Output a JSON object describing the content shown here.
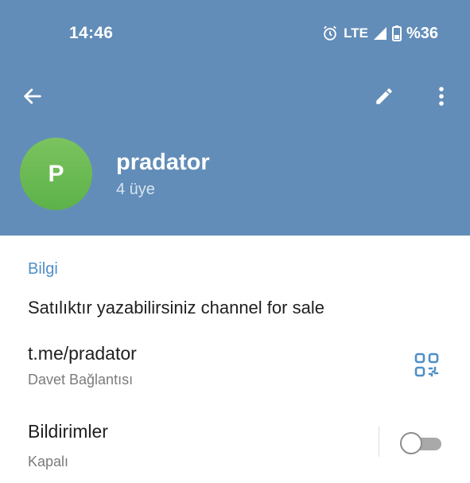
{
  "status_bar": {
    "time": "14:46",
    "network": "LTE",
    "battery": "%36",
    "icons": [
      "alarm-icon",
      "signal-icon",
      "battery-icon"
    ]
  },
  "toolbar": {
    "icons": [
      "back-arrow-icon",
      "edit-pencil-icon",
      "more-vert-icon"
    ]
  },
  "profile": {
    "avatar_letter": "P",
    "name": "pradator",
    "members": "4 üye"
  },
  "info": {
    "section_title": "Bilgi",
    "description": "Satılıktır yazabilirsiniz channel for sale",
    "link": "t.me/pradator",
    "link_caption": "Davet Bağlantısı",
    "link_icon": "qr-code-icon"
  },
  "notifications": {
    "title": "Bildirimler",
    "state": "Kapalı",
    "enabled": false
  },
  "colors": {
    "header": "#628db8",
    "accent": "#4f8fc7",
    "avatar": "#6aba52"
  }
}
